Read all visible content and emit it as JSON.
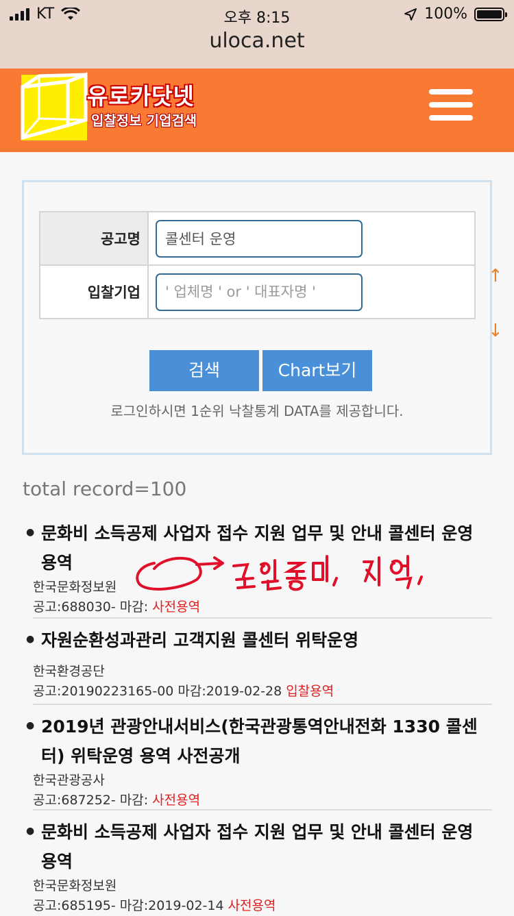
{
  "status_bar": {
    "carrier": "KT",
    "time": "오후 8:15",
    "battery": "100%"
  },
  "browser": {
    "url": "uloca.net"
  },
  "header": {
    "brand": "유로카닷넷",
    "tagline": "입찰정보 기업검색",
    "colors": {
      "background": "#fb7a33",
      "cube": "#ffee00"
    }
  },
  "search": {
    "title_label": "공고명",
    "title_value": "콜센터 운영",
    "company_label": "입찰기업",
    "company_placeholder": "' 업체명 ' or ' 대표자명 '",
    "search_button": "검색",
    "chart_button": "Chart보기",
    "notice": "로그인하시면 1순위 낙찰통계 DATA를 제공합니다.",
    "scroll_up": "↑",
    "scroll_down": "↓"
  },
  "results": {
    "total": "total record=100",
    "items": [
      {
        "title": "문화비 소득공제 사업자 접수 지원 업무 및 안내 콜센터 운영 용역",
        "agency": "한국문화정보원",
        "meta": "공고:688030- 마감:",
        "tag": "사전용역"
      },
      {
        "title": "자원순환성과관리 고객지원 콜센터 위탁운영",
        "agency": "한국환경공단",
        "meta": "공고:20190223165-00 마감:2019-02-28",
        "tag": "입찰용역"
      },
      {
        "title": "2019년 관광안내서비스(한국관광통역안내전화 1330 콜센터) 위탁운영 용역 사전공개",
        "agency": "한국관광공사",
        "meta": "공고:687252- 마감:",
        "tag": "사전용역"
      },
      {
        "title": "문화비 소득공제 사업자 접수 지원 업무 및 안내 콜센터 운영 용역",
        "agency": "한국문화정보원",
        "meta": "공고:685195- 마감:2019-02-14",
        "tag": "사전용역"
      }
    ]
  },
  "annotation": {
    "handwritten": "금액통계, 지역,"
  }
}
